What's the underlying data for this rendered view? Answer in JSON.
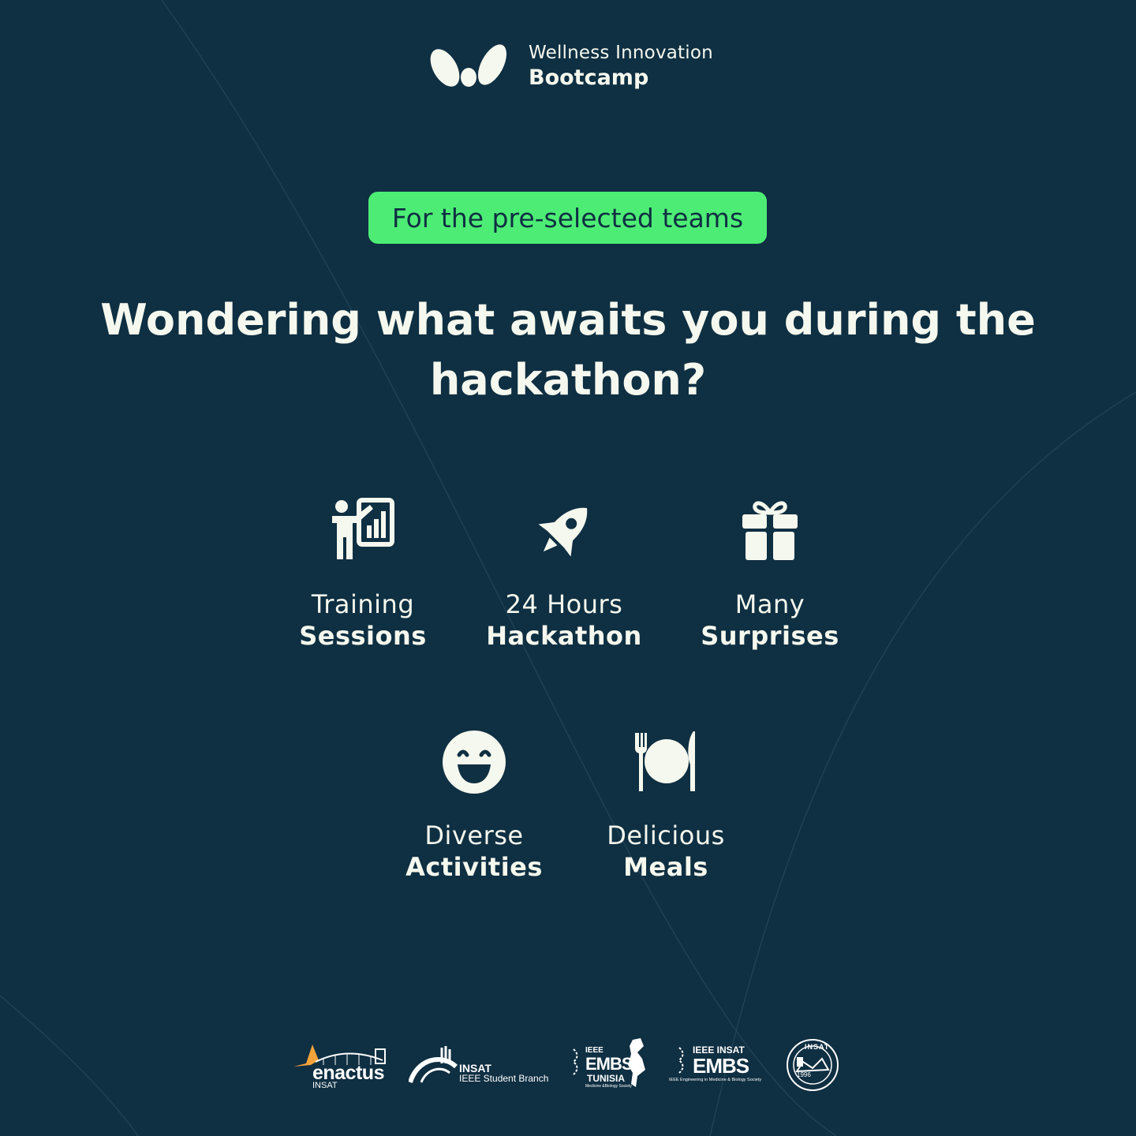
{
  "brand": {
    "subtitle": "Wellness Innovation",
    "title": "Bootcamp",
    "logo_icon": "w-logo-icon"
  },
  "badge": {
    "label": "For the pre-selected teams",
    "color": "#4ded75"
  },
  "headline": {
    "line1": "Wondering what awaits you during the",
    "line2": "hackathon?"
  },
  "features": [
    {
      "icon": "presentation-icon",
      "line1": "Training",
      "line2": "Sessions"
    },
    {
      "icon": "rocket-icon",
      "line1": "24 Hours",
      "line2": "Hackathon"
    },
    {
      "icon": "gift-icon",
      "line1": "Many",
      "line2": "Surprises"
    },
    {
      "icon": "smile-icon",
      "line1": "Diverse",
      "line2": "Activities"
    },
    {
      "icon": "plate-cutlery-icon",
      "line1": "Delicious",
      "line2": "Meals"
    }
  ],
  "partners": [
    {
      "name": "enactus",
      "sub": "INSAT",
      "icon": "enactus-logo"
    },
    {
      "name": "INSAT",
      "sub": "IEEE Student Branch",
      "icon": "insat-ieee-sb-logo"
    },
    {
      "name": "EMBS",
      "top": "IEEE",
      "sub": "TUNISIA",
      "tagline": "Medicine &Biology Society",
      "icon": "ieee-embs-tunisia-logo"
    },
    {
      "name": "EMBS",
      "top": "IEEE INSAT",
      "tagline": "IEEE Engineering in Medicine & Biology Society",
      "icon": "ieee-insat-embs-logo"
    },
    {
      "name": "INSAT",
      "year": "1996",
      "icon": "insat-seal-logo"
    }
  ],
  "colors": {
    "background": "#0f2f42",
    "foreground": "#f5f8ee",
    "accent": "#4ded75",
    "enactus_orange": "#f2a33a"
  }
}
